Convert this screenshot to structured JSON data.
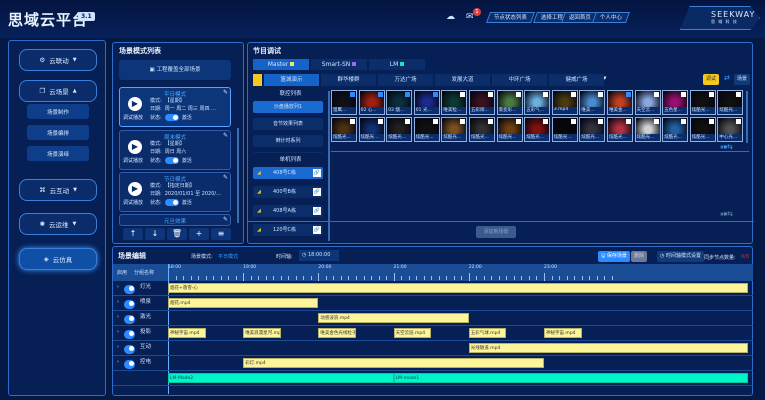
{
  "header": {
    "title": "思域云平台",
    "version": "3.1",
    "notif_count": "1",
    "nav": [
      "节点状态列表",
      "选择工程",
      "返回首页",
      "个人中心"
    ],
    "logo": "SEEKWAY",
    "logo_sub": "思 域 科 技"
  },
  "sidebar": {
    "items": [
      {
        "label": "云联动",
        "icon": "link-icon"
      },
      {
        "label": "云场景",
        "icon": "layers-icon",
        "sub": [
          "场景制作",
          "场景编排",
          "场景演绎"
        ]
      },
      {
        "label": "云互动",
        "icon": "interact-icon"
      },
      {
        "label": "云运维",
        "icon": "brain-icon"
      },
      {
        "label": "云仿真",
        "icon": "simulation-icon",
        "active": true
      }
    ]
  },
  "scene_list": {
    "title": "场景模式列表",
    "apply_all": "工程覆盖全部场景",
    "play_label": "调试播放",
    "mode_label": "模式:",
    "date_label": "日期:",
    "state_label": "状态:",
    "state_value": "激活",
    "cards": [
      {
        "name": "平日模式",
        "mode": "【星期】",
        "date": "周一 周二 周三 周四 ..."
      },
      {
        "name": "周末模式",
        "mode": "【星期】",
        "date": "周日 周六"
      },
      {
        "name": "节日模式",
        "mode": "【指定日期】",
        "date": "2020/01/01 至 2020/..."
      },
      {
        "name": "元旦效果"
      }
    ]
  },
  "program": {
    "title": "节目调试",
    "tabs": [
      {
        "label": "Master",
        "color": "#f5e663"
      },
      {
        "label": "Smart-SN",
        "color": "#9a6cf0"
      },
      {
        "label": "LM",
        "color": "#22e0c0"
      }
    ],
    "subtabs": [
      "篮城演示",
      "群华楼群",
      "万达广场",
      "发展大道",
      "中环广场",
      "健威广场"
    ],
    "debug": "调试",
    "scene": "场景",
    "linked_title": "联控列表",
    "linked": [
      "沙盘播放列1",
      "音节效果列表",
      "倒计时系列",
      "智能中控系列"
    ],
    "single_title": "单机列表",
    "single": [
      "408号C栋",
      "400号B栋",
      "408号A栋",
      "120号C栋"
    ],
    "add_to_scene": "添加到场景",
    "thumbs_row1": [
      {
        "l": "猎鹰...",
        "c": "#101018",
        "k": 1
      },
      {
        "l": "02 心...",
        "c": "#a02010",
        "k": 1
      },
      {
        "l": "03 烟...",
        "c": "#0a3040",
        "k": 1
      },
      {
        "l": "01 光...",
        "c": "#1a2a90",
        "k": 1
      },
      {
        "l": "唯美粒...",
        "c": "#0a3a30"
      },
      {
        "l": "五彩缤...",
        "c": "#3a1020"
      },
      {
        "l": "渐变彩...",
        "c": "#4a7a40"
      },
      {
        "l": "五彩气...",
        "c": "#6ab0e0"
      },
      {
        "l": "3.mp4",
        "c": "#4a3a10"
      },
      {
        "l": "唯美...",
        "c": "#4a8ad0"
      },
      {
        "l": "唯美金...",
        "c": "#c04020",
        "k": 1
      },
      {
        "l": "天空云...",
        "c": "#8aa8e0"
      },
      {
        "l": "五色星...",
        "c": "#9a1070"
      },
      {
        "l": "炫酷光...",
        "c": "#101010"
      },
      {
        "l": "炫酷光...",
        "c": "#101010"
      }
    ],
    "thumbs_row2": [
      {
        "l": "炫酷光...",
        "c": "#4a3010"
      },
      {
        "l": "炫酷光...",
        "c": "#103070"
      },
      {
        "l": "炫酷光...",
        "c": "#202020"
      },
      {
        "l": "炫酷光...",
        "c": "#101010"
      },
      {
        "l": "炫酷光...",
        "c": "#7a5020"
      },
      {
        "l": "炫酷光...",
        "c": "#303030"
      },
      {
        "l": "炫酷光...",
        "c": "#6a4010"
      },
      {
        "l": "炫酷光...",
        "c": "#801010"
      },
      {
        "l": "炫酷光...",
        "c": "#080808"
      },
      {
        "l": "炫酷光...",
        "c": "#303040"
      },
      {
        "l": "炫酷光...",
        "c": "#b03040"
      },
      {
        "l": "炫酷光...",
        "c": "#d0d0d0"
      },
      {
        "l": "炫酷光...",
        "c": "#2060a0"
      },
      {
        "l": "炫酷光...",
        "c": "#101010"
      },
      {
        "l": "中心光...",
        "c": "#505050"
      }
    ]
  },
  "editor": {
    "title": "场景编辑",
    "mode_label": "场景模式:",
    "mode_value": "平日模式",
    "time_label": "时间轴:",
    "time_value": "18:00:00",
    "save": "保存场景",
    "delete": "删除",
    "timeline_settings": "时间轴模式设置",
    "sync_label": "同步节点数量:",
    "sync_value": "0/0",
    "col_enable": "启用",
    "col_group": "分组名称",
    "ticks": [
      "18:00",
      "19:00",
      "20:00",
      "21:00",
      "22:00",
      "23:00"
    ],
    "tracks": [
      {
        "name": "灯光",
        "clips": [
          {
            "t": "烟花+落雪-心",
            "s": "18:00",
            "e": ""
          }
        ]
      },
      {
        "name": "喷泉",
        "clips": [
          {
            "t": "烟花.mp4",
            "s": "18:00",
            "e": "20:00"
          }
        ]
      },
      {
        "name": "激光",
        "clips": [
          {
            "t": "动感波浪.mp4",
            "s": "20:00",
            "e": "22:00"
          }
        ]
      },
      {
        "name": "投影",
        "clips": [
          {
            "t": "神秘宇宙.mp4",
            "s": "18:00",
            "e": "18:30"
          },
          {
            "t": "唯美浪漫星河.mp4",
            "s": "19:00",
            "e": "19:30"
          },
          {
            "t": "唯美金色光线粒子...",
            "s": "20:00",
            "e": "20:30"
          },
          {
            "t": "天空云层.mp4",
            "s": "21:00",
            "e": "21:30"
          },
          {
            "t": "五彩气球.mp4",
            "s": "22:00",
            "e": "22:30"
          },
          {
            "t": "神秘宇宙.mp4",
            "s": "23:00",
            "e": "23:30"
          }
        ]
      },
      {
        "name": "互动",
        "clips": [
          {
            "t": "光线隧道.mp4",
            "s": "22:00",
            "e": ""
          }
        ]
      },
      {
        "name": "控电",
        "clips": [
          {
            "t": "彩灯.mp4",
            "s": "19:00",
            "e": "23:00"
          }
        ]
      },
      {
        "name": "",
        "lm": true,
        "clips": [
          {
            "t": "LM-Mode2",
            "s": "18:00",
            "e": "21:00"
          },
          {
            "t": "LM-mode1",
            "s": "21:00",
            "e": ""
          }
        ]
      }
    ]
  }
}
